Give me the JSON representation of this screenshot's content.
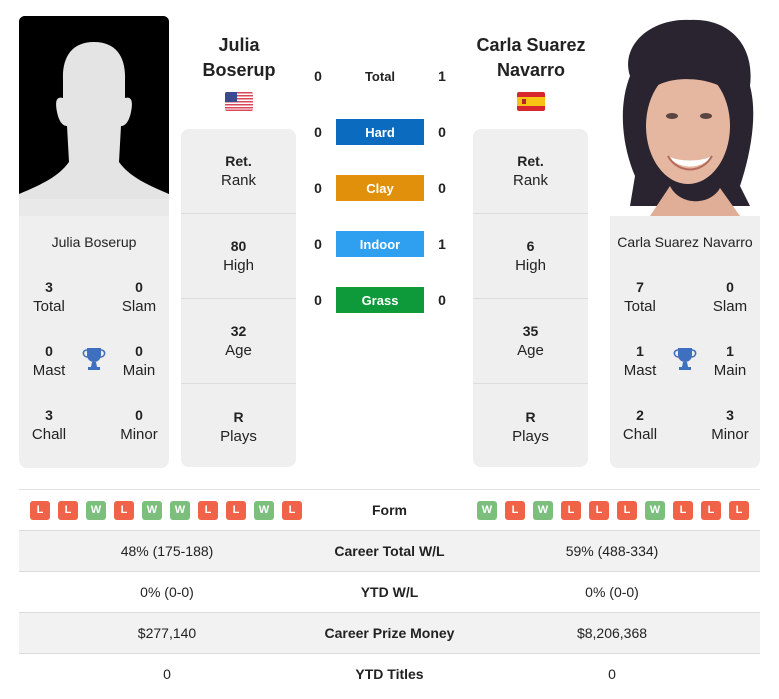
{
  "player1": {
    "name_line1": "Julia",
    "name_line2": "Boserup",
    "full_name": "Julia Boserup",
    "country_flag": "usa-flag",
    "photo": "silhouette-placeholder",
    "titles": {
      "total": {
        "value": "3",
        "label": "Total"
      },
      "slam": {
        "value": "0",
        "label": "Slam"
      },
      "mast": {
        "value": "0",
        "label": "Mast"
      },
      "main": {
        "value": "0",
        "label": "Main"
      },
      "chall": {
        "value": "3",
        "label": "Chall"
      },
      "minor": {
        "value": "0",
        "label": "Minor"
      }
    },
    "rank": [
      {
        "value": "Ret.",
        "label": "Rank"
      },
      {
        "value": "80",
        "label": "High"
      },
      {
        "value": "32",
        "label": "Age"
      },
      {
        "value": "R",
        "label": "Plays"
      }
    ],
    "form": [
      "L",
      "L",
      "W",
      "L",
      "W",
      "W",
      "L",
      "L",
      "W",
      "L"
    ]
  },
  "player2": {
    "name_line1": "Carla Suarez",
    "name_line2": "Navarro",
    "full_name": "Carla Suarez Navarro",
    "country_flag": "spain-flag",
    "photo": "player-photo",
    "titles": {
      "total": {
        "value": "7",
        "label": "Total"
      },
      "slam": {
        "value": "0",
        "label": "Slam"
      },
      "mast": {
        "value": "1",
        "label": "Mast"
      },
      "main": {
        "value": "1",
        "label": "Main"
      },
      "chall": {
        "value": "2",
        "label": "Chall"
      },
      "minor": {
        "value": "3",
        "label": "Minor"
      }
    },
    "rank": [
      {
        "value": "Ret.",
        "label": "Rank"
      },
      {
        "value": "6",
        "label": "High"
      },
      {
        "value": "35",
        "label": "Age"
      },
      {
        "value": "R",
        "label": "Plays"
      }
    ],
    "form": [
      "W",
      "L",
      "W",
      "L",
      "L",
      "L",
      "W",
      "L",
      "L",
      "L"
    ]
  },
  "h2h": [
    {
      "label": "Total",
      "p1": "0",
      "p2": "1",
      "color": null
    },
    {
      "label": "Hard",
      "p1": "0",
      "p2": "0",
      "color": "#0b6cbf"
    },
    {
      "label": "Clay",
      "p1": "0",
      "p2": "0",
      "color": "#e0900a"
    },
    {
      "label": "Indoor",
      "p1": "0",
      "p2": "1",
      "color": "#2f9ff0"
    },
    {
      "label": "Grass",
      "p1": "0",
      "p2": "0",
      "color": "#0e9a3b"
    }
  ],
  "form_label": "Form",
  "stats": [
    {
      "label": "Career Total W/L",
      "p1": "48% (175-188)",
      "p2": "59% (488-334)"
    },
    {
      "label": "YTD W/L",
      "p1": "0% (0-0)",
      "p2": "0% (0-0)"
    },
    {
      "label": "Career Prize Money",
      "p1": "$277,140",
      "p2": "$8,206,368"
    },
    {
      "label": "YTD Titles",
      "p1": "0",
      "p2": "0"
    }
  ],
  "colors": {
    "win": "#7cbf7c",
    "loss": "#f06348",
    "trophy": "#3f6fbf",
    "card_bg": "#efefef"
  }
}
